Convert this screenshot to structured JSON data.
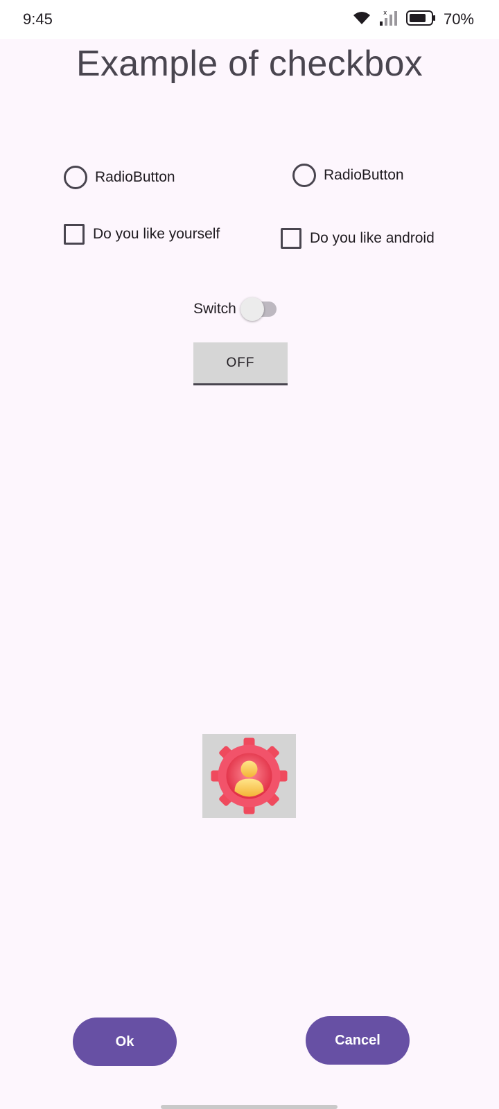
{
  "status_bar": {
    "time": "9:45",
    "battery_percent": "70%",
    "icons": [
      "wifi-icon",
      "signal-icon",
      "battery-icon"
    ]
  },
  "title": "Example of checkbox",
  "radios": [
    {
      "label": "RadioButton",
      "checked": false
    },
    {
      "label": "RadioButton",
      "checked": false
    }
  ],
  "checkboxes": [
    {
      "label": "Do you like yourself",
      "checked": false
    },
    {
      "label": "Do you like android",
      "checked": false
    }
  ],
  "switch": {
    "label": "Switch",
    "on": false
  },
  "toggle_button": {
    "label": "OFF"
  },
  "image": {
    "icon": "user-settings-gear-icon"
  },
  "buttons": {
    "ok": "Ok",
    "cancel": "Cancel"
  },
  "colors": {
    "accent": "#6750a4",
    "background": "#fdf6fd"
  }
}
